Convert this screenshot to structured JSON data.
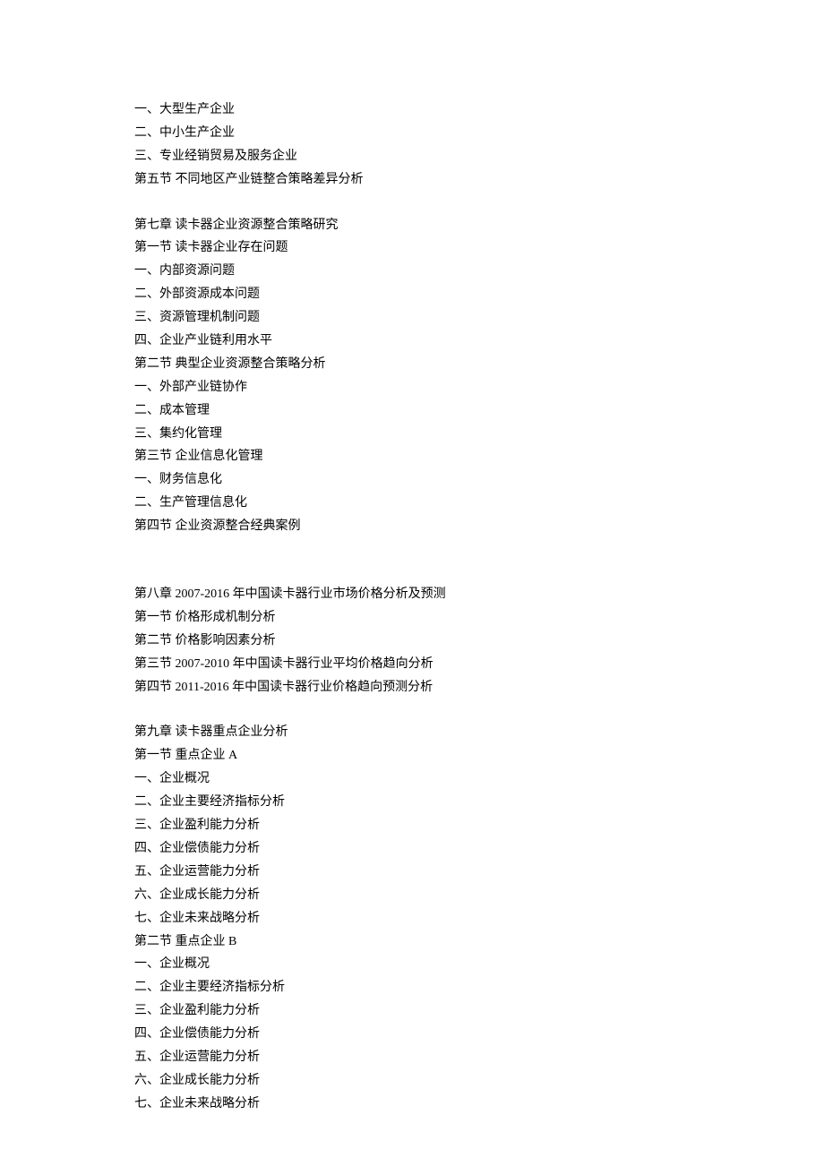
{
  "section1": {
    "lines": [
      "一、大型生产企业",
      "二、中小生产企业",
      "三、专业经销贸易及服务企业",
      "第五节  不同地区产业链整合策略差异分析"
    ]
  },
  "chapter7": {
    "title": "第七章  读卡器企业资源整合策略研究",
    "lines": [
      "第一节  读卡器企业存在问题",
      "一、内部资源问题",
      "二、外部资源成本问题",
      "三、资源管理机制问题",
      "四、企业产业链利用水平",
      "第二节  典型企业资源整合策略分析",
      "一、外部产业链协作",
      "二、成本管理",
      "三、集约化管理",
      "第三节  企业信息化管理",
      "一、财务信息化",
      "二、生产管理信息化",
      "第四节  企业资源整合经典案例"
    ]
  },
  "chapter8": {
    "title": "第八章  2007-2016 年中国读卡器行业市场价格分析及预测",
    "lines": [
      "第一节  价格形成机制分析",
      "第二节  价格影响因素分析",
      "第三节  2007-2010 年中国读卡器行业平均价格趋向分析",
      "第四节  2011-2016 年中国读卡器行业价格趋向预测分析"
    ]
  },
  "chapter9": {
    "title": "第九章  读卡器重点企业分析",
    "lines": [
      "第一节  重点企业 A",
      "一、企业概况",
      "二、企业主要经济指标分析",
      "三、企业盈利能力分析",
      "四、企业偿债能力分析",
      "五、企业运营能力分析",
      "六、企业成长能力分析",
      "七、企业未来战略分析",
      "第二节  重点企业 B",
      "一、企业概况",
      "二、企业主要经济指标分析",
      "三、企业盈利能力分析",
      "四、企业偿债能力分析",
      "五、企业运营能力分析",
      "六、企业成长能力分析",
      "七、企业未来战略分析"
    ]
  }
}
